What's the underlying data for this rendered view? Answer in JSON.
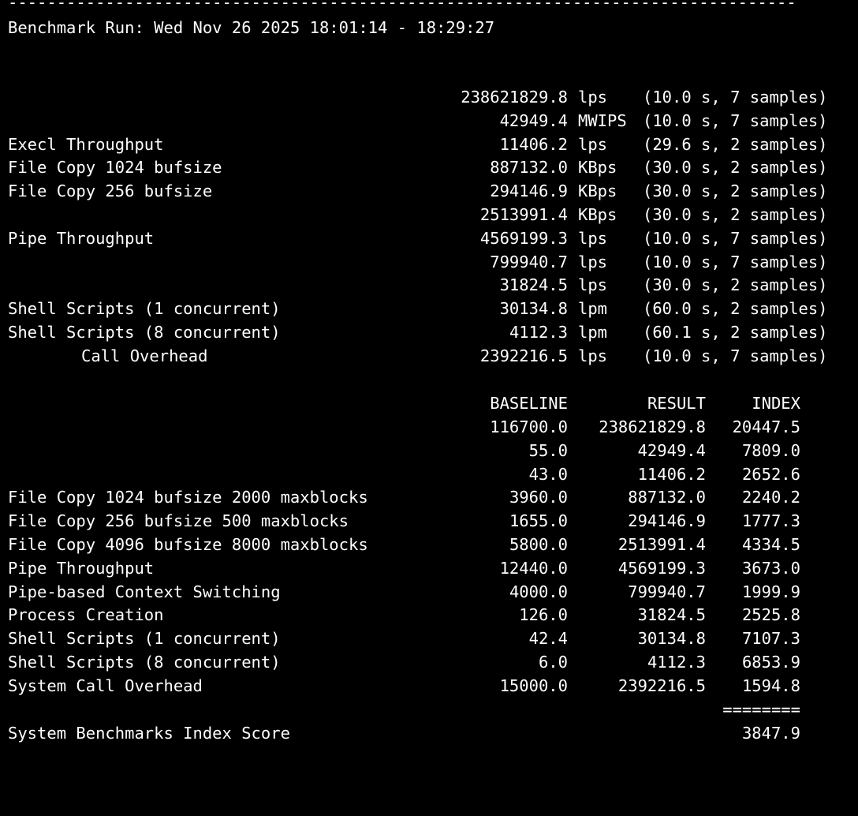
{
  "terminal": {
    "rule_top": "---------------------------------------------------------------------------------------------------",
    "run_header": "Benchmark Run: Wed Nov 26 2025 18:01:14 - 18:29:27",
    "raw_results": [
      {
        "label": "",
        "value": "238621829.8",
        "unit": "lps",
        "info": "(10.0 s, 7 samples)"
      },
      {
        "label": "",
        "value": "42949.4",
        "unit": "MWIPS",
        "info": "(10.0 s, 7 samples)"
      },
      {
        "label": "Execl Throughput",
        "value": "11406.2",
        "unit": "lps",
        "info": "(29.6 s, 2 samples)"
      },
      {
        "label": "File Copy 1024 bufsize",
        "value": "887132.0",
        "unit": "KBps",
        "info": "(30.0 s, 2 samples)"
      },
      {
        "label": "File Copy 256 bufsize",
        "value": "294146.9",
        "unit": "KBps",
        "info": "(30.0 s, 2 samples)"
      },
      {
        "label": "",
        "value": "2513991.4",
        "unit": "KBps",
        "info": "(30.0 s, 2 samples)"
      },
      {
        "label": "Pipe Throughput",
        "value": "4569199.3",
        "unit": "lps",
        "info": "(10.0 s, 7 samples)"
      },
      {
        "label": "",
        "value": "799940.7",
        "unit": "lps",
        "info": "(10.0 s, 7 samples)"
      },
      {
        "label": "",
        "value": "31824.5",
        "unit": "lps",
        "info": "(30.0 s, 2 samples)"
      },
      {
        "label": "Shell Scripts (1 concurrent)",
        "value": "30134.8",
        "unit": "lpm",
        "info": "(60.0 s, 2 samples)"
      },
      {
        "label": "Shell Scripts (8 concurrent)",
        "value": "4112.3",
        "unit": "lpm",
        "info": "(60.1 s, 2 samples)"
      },
      {
        "label": "Call Overhead",
        "value": "2392216.5",
        "unit": "lps",
        "info": "(10.0 s, 7 samples)"
      }
    ],
    "index_headers": {
      "baseline": "BASELINE",
      "result": "RESULT",
      "index": "INDEX"
    },
    "index_results": [
      {
        "label": "",
        "baseline": "116700.0",
        "result": "238621829.8",
        "index": "20447.5"
      },
      {
        "label": "",
        "baseline": "55.0",
        "result": "42949.4",
        "index": "7809.0"
      },
      {
        "label": "",
        "baseline": "43.0",
        "result": "11406.2",
        "index": "2652.6"
      },
      {
        "label": "File Copy 1024 bufsize 2000 maxblocks",
        "baseline": "3960.0",
        "result": "887132.0",
        "index": "2240.2"
      },
      {
        "label": "File Copy 256 bufsize 500 maxblocks",
        "baseline": "1655.0",
        "result": "294146.9",
        "index": "1777.3"
      },
      {
        "label": "File Copy 4096 bufsize 8000 maxblocks",
        "baseline": "5800.0",
        "result": "2513991.4",
        "index": "4334.5"
      },
      {
        "label": "Pipe Throughput",
        "baseline": "12440.0",
        "result": "4569199.3",
        "index": "3673.0"
      },
      {
        "label": "Pipe-based Context Switching",
        "baseline": "4000.0",
        "result": "799940.7",
        "index": "1999.9"
      },
      {
        "label": "Process Creation",
        "baseline": "126.0",
        "result": "31824.5",
        "index": "2525.8"
      },
      {
        "label": "Shell Scripts (1 concurrent)",
        "baseline": "42.4",
        "result": "30134.8",
        "index": "7107.3"
      },
      {
        "label": "Shell Scripts (8 concurrent)",
        "baseline": "6.0",
        "result": "4112.3",
        "index": "6853.9"
      },
      {
        "label": "System Call Overhead",
        "baseline": "15000.0",
        "result": "2392216.5",
        "index": "1594.8"
      }
    ],
    "separator": "========",
    "score_label": "System Benchmarks Index Score",
    "score_value": "3847.9"
  }
}
